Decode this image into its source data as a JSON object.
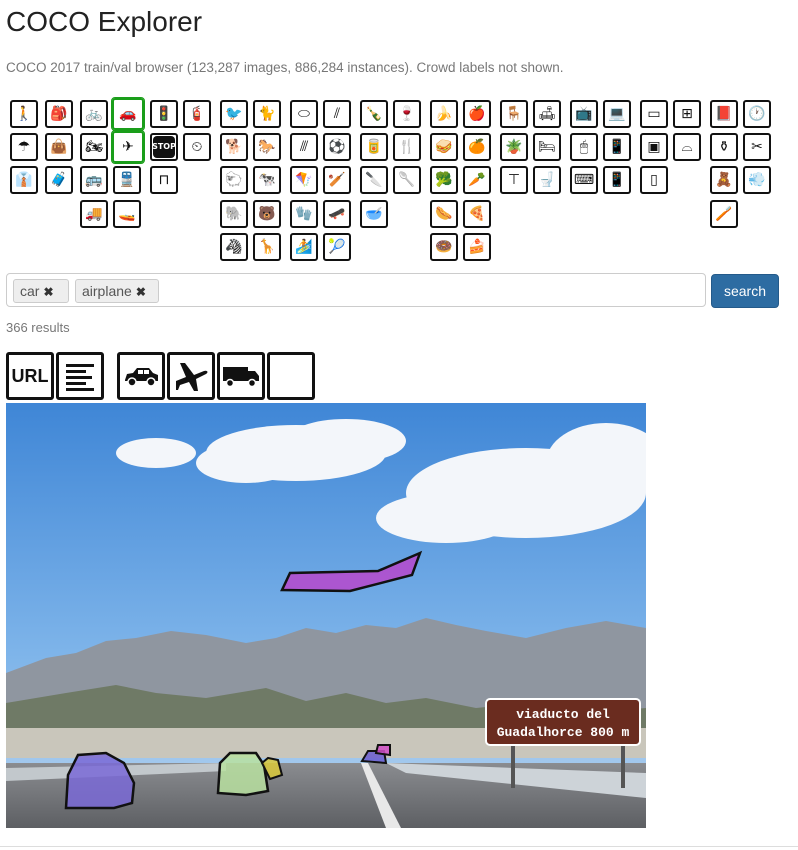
{
  "header": {
    "title": "COCO Explorer",
    "subtitle": "COCO 2017 train/val browser (123,287 images, 886,284 instances). Crowd labels not shown."
  },
  "category_icons": [
    {
      "name": "person-icon",
      "glyph": "🚶",
      "selected": false
    },
    {
      "name": "bicycle-icon",
      "glyph": "🚲",
      "selected": false
    },
    {
      "name": "car-icon",
      "glyph": "🚗",
      "selected": true
    },
    {
      "name": "airplane-icon",
      "glyph": "✈",
      "selected": true
    },
    {
      "name": "traffic-light-icon",
      "glyph": "🚦",
      "selected": false
    },
    {
      "name": "stop-sign-icon",
      "glyph": "STOP",
      "selected": false
    }
  ],
  "search": {
    "tags": [
      {
        "label": "car"
      },
      {
        "label": "airplane"
      }
    ],
    "button_label": "search",
    "remove_glyph": "✖"
  },
  "results": {
    "count_text": "366 results"
  },
  "toolbar": {
    "url_label": "URL",
    "buttons": [
      {
        "name": "url-button"
      },
      {
        "name": "caption-button"
      },
      {
        "name": "car-filter-button"
      },
      {
        "name": "airplane-filter-button"
      },
      {
        "name": "truck-filter-button"
      },
      {
        "name": "blank-filter-button"
      }
    ]
  },
  "photo": {
    "sign_line1": "viaducto del",
    "sign_line2": "Guadalhorce 800 m",
    "sky_color": "#5a9be0",
    "airplane_mask_color": "#c23bc9",
    "car_mask_color": "#7a6ad6",
    "car2_mask_color": "#b8e0a0"
  },
  "colors": {
    "selected_border": "#1a9e1a",
    "search_button": "#2d6ca2"
  }
}
